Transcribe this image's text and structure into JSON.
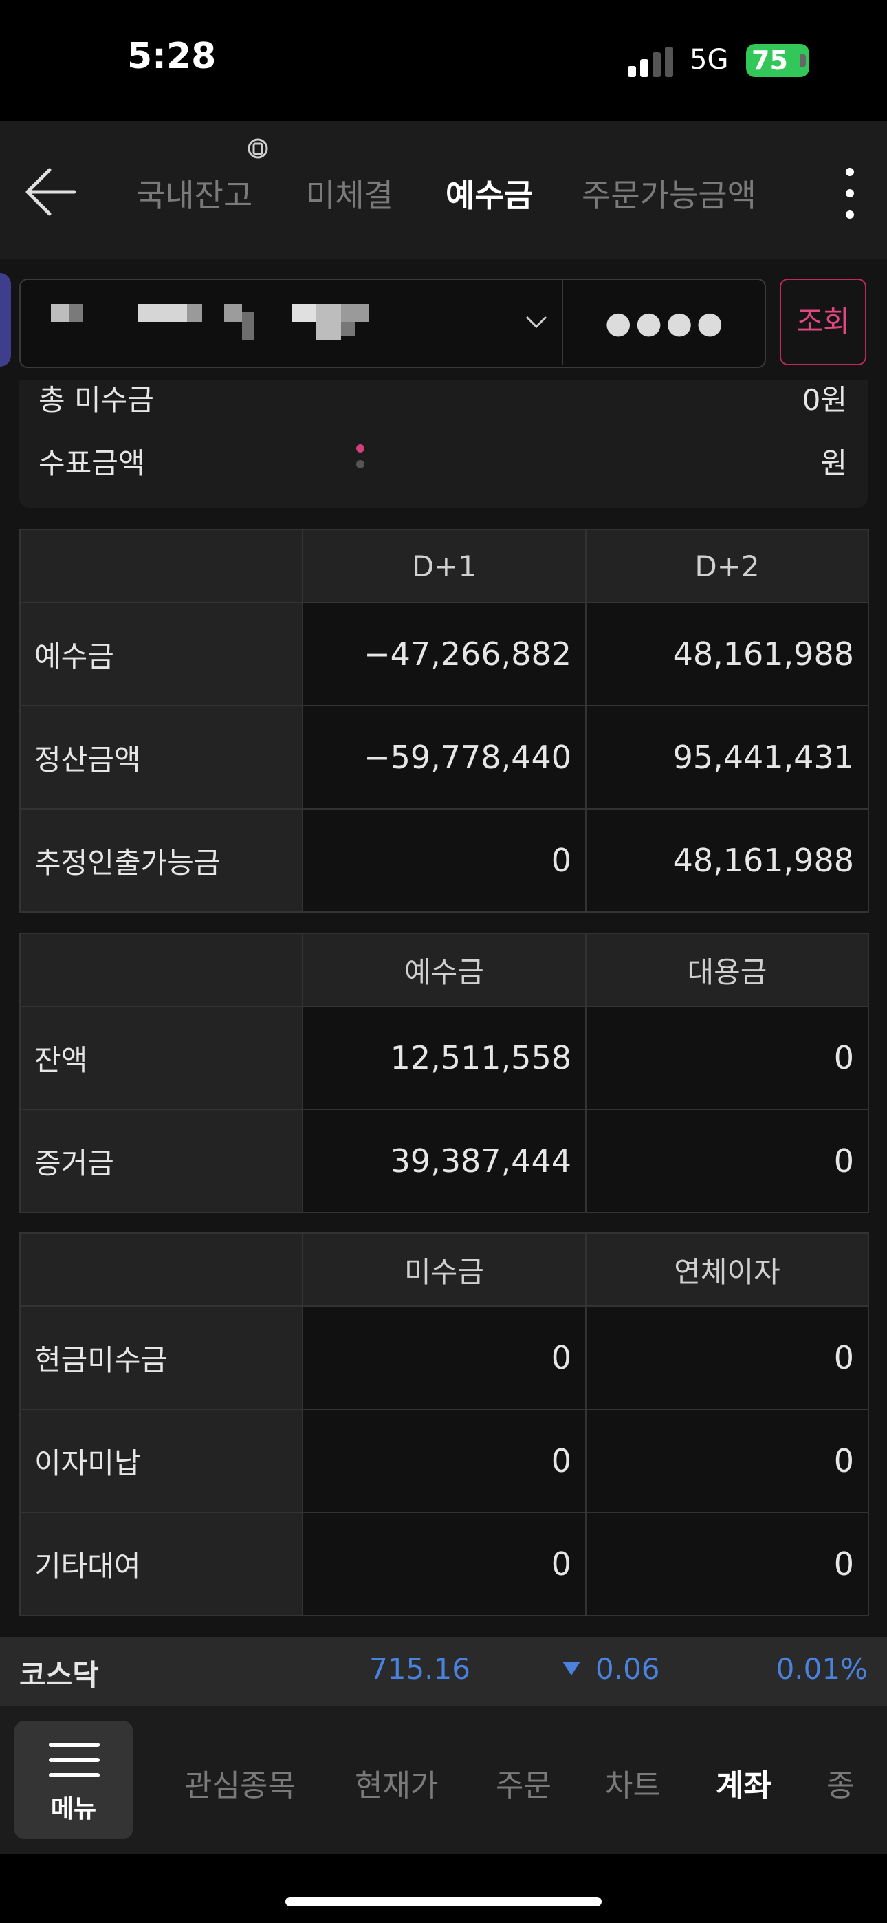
{
  "status_bar": {
    "time": "5:28",
    "network": "5G",
    "battery": "75"
  },
  "header": {
    "tabs": [
      {
        "label": "국내잔고"
      },
      {
        "label": "미체결"
      },
      {
        "label": "예수금"
      },
      {
        "label": "주문가능금액"
      }
    ],
    "active_tab": "예수금"
  },
  "account": {
    "password_mask": "●●●●",
    "query_label": "조회"
  },
  "summary": {
    "rows": [
      {
        "label": "총 미수금",
        "value": "0원"
      },
      {
        "label": "수표금액",
        "value": "원"
      }
    ]
  },
  "table_settlement": {
    "columns": [
      "",
      "D+1",
      "D+2"
    ],
    "rows": [
      {
        "label": "예수금",
        "values": [
          "−47,266,882",
          "48,161,988"
        ]
      },
      {
        "label": "정산금액",
        "values": [
          "−59,778,440",
          "95,441,431"
        ]
      },
      {
        "label": "추정인출가능금",
        "values": [
          "0",
          "48,161,988"
        ]
      }
    ]
  },
  "table_deposit": {
    "columns": [
      "",
      "예수금",
      "대용금"
    ],
    "rows": [
      {
        "label": "잔액",
        "values": [
          "12,511,558",
          "0"
        ]
      },
      {
        "label": "증거금",
        "values": [
          "39,387,444",
          "0"
        ]
      }
    ]
  },
  "table_unpaid": {
    "columns": [
      "",
      "미수금",
      "연체이자"
    ],
    "rows": [
      {
        "label": "현금미수금",
        "values": [
          "0",
          "0"
        ]
      },
      {
        "label": "이자미납",
        "values": [
          "0",
          "0"
        ]
      },
      {
        "label": "기타대여",
        "values": [
          "0",
          "0"
        ]
      }
    ]
  },
  "ticker": {
    "label": "코스닥",
    "price": "715.16",
    "change": "0.06",
    "change_pct": "0.01%",
    "color": "#4a82de"
  },
  "bottom_nav": {
    "menu_label": "메뉴",
    "items": [
      {
        "label": "관심종목"
      },
      {
        "label": "현재가"
      },
      {
        "label": "주문"
      },
      {
        "label": "차트"
      },
      {
        "label": "계좌"
      },
      {
        "label": "종"
      }
    ],
    "active_item": "계좌"
  },
  "icons": [
    "back-arrow-icon",
    "sync-icon",
    "more-vertical-icon",
    "chevron-down-icon",
    "hamburger-icon",
    "down-triangle-icon"
  ]
}
